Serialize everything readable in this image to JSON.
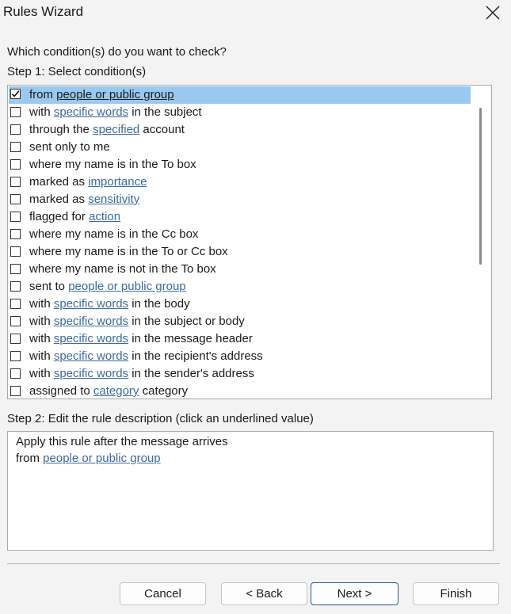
{
  "window": {
    "title": "Rules Wizard"
  },
  "prompt": "Which condition(s) do you want to check?",
  "step1": {
    "label": "Step 1: Select condition(s)",
    "conditions": [
      {
        "checked": true,
        "pre": "from ",
        "link": "people or public group",
        "post": ""
      },
      {
        "checked": false,
        "pre": "with ",
        "link": "specific words",
        "post": " in the subject"
      },
      {
        "checked": false,
        "pre": "through the ",
        "link": "specified",
        "post": " account"
      },
      {
        "checked": false,
        "pre": "sent only to me",
        "link": "",
        "post": ""
      },
      {
        "checked": false,
        "pre": "where my name is in the To box",
        "link": "",
        "post": ""
      },
      {
        "checked": false,
        "pre": "marked as ",
        "link": "importance",
        "post": ""
      },
      {
        "checked": false,
        "pre": "marked as ",
        "link": "sensitivity",
        "post": ""
      },
      {
        "checked": false,
        "pre": "flagged for ",
        "link": "action",
        "post": ""
      },
      {
        "checked": false,
        "pre": "where my name is in the Cc box",
        "link": "",
        "post": ""
      },
      {
        "checked": false,
        "pre": "where my name is in the To or Cc box",
        "link": "",
        "post": ""
      },
      {
        "checked": false,
        "pre": "where my name is not in the To box",
        "link": "",
        "post": ""
      },
      {
        "checked": false,
        "pre": "sent to ",
        "link": "people or public group",
        "post": ""
      },
      {
        "checked": false,
        "pre": "with ",
        "link": "specific words",
        "post": " in the body"
      },
      {
        "checked": false,
        "pre": "with ",
        "link": "specific words",
        "post": " in the subject or body"
      },
      {
        "checked": false,
        "pre": "with ",
        "link": "specific words",
        "post": " in the message header"
      },
      {
        "checked": false,
        "pre": "with ",
        "link": "specific words",
        "post": " in the recipient's address"
      },
      {
        "checked": false,
        "pre": "with ",
        "link": "specific words",
        "post": " in the sender's address"
      },
      {
        "checked": false,
        "pre": "assigned to ",
        "link": "category",
        "post": " category"
      }
    ]
  },
  "step2": {
    "label": "Step 2: Edit the rule description (click an underlined value)",
    "line1": "Apply this rule after the message arrives",
    "line2_pre": "from ",
    "line2_link": "people or public group"
  },
  "buttons": {
    "cancel": "Cancel",
    "back": "< Back",
    "next": "Next >",
    "finish": "Finish"
  },
  "colors": {
    "selection": "#99c9ef",
    "link": "#3c6a9e",
    "primary_border": "#2d5a8c"
  }
}
